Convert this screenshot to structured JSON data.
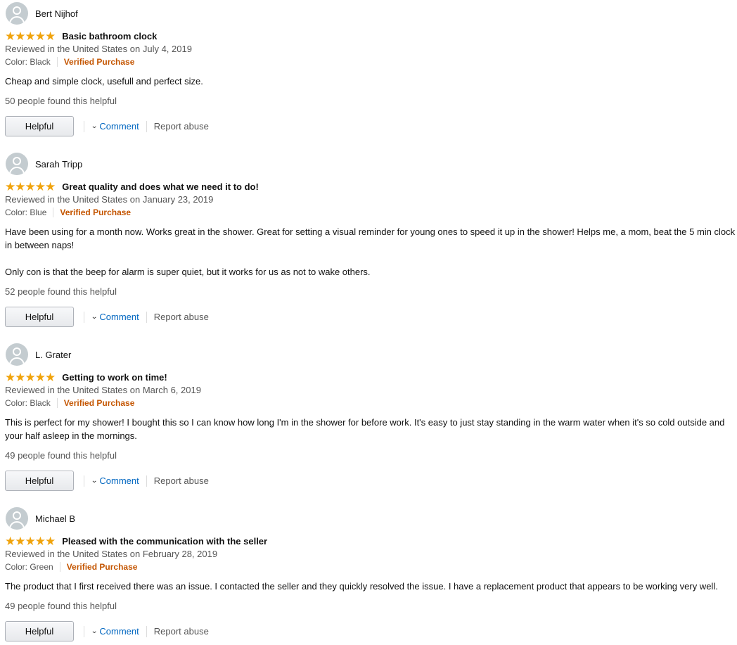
{
  "reviews": [
    {
      "name": "Bert Nijhof",
      "rating": 5,
      "title": "Basic bathroom clock",
      "date": "Reviewed in the United States on July 4, 2019",
      "color": "Color: Black",
      "verified": "Verified Purchase",
      "body": [
        "Cheap and simple clock, usefull and perfect size."
      ],
      "helpful_count": "50 people found this helpful"
    },
    {
      "name": "Sarah Tripp",
      "rating": 5,
      "title": "Great quality and does what we need it to do!",
      "date": "Reviewed in the United States on January 23, 2019",
      "color": "Color: Blue",
      "verified": "Verified Purchase",
      "body": [
        "Have been using for a month now. Works great in the shower. Great for setting a visual reminder for young ones to speed it up in the shower! Helps me, a mom, beat the 5 min clock in between naps!",
        "Only con is that the beep for alarm is super quiet, but it works for us as not to wake others."
      ],
      "helpful_count": "52 people found this helpful"
    },
    {
      "name": "L. Grater",
      "rating": 5,
      "title": "Getting to work on time!",
      "date": "Reviewed in the United States on March 6, 2019",
      "color": "Color: Black",
      "verified": "Verified Purchase",
      "body": [
        "This is perfect for my shower! I bought this so I can know how long I'm in the shower for before work. It's easy to just stay standing in the warm water when it's so cold outside and your half asleep in the mornings."
      ],
      "helpful_count": "49 people found this helpful"
    },
    {
      "name": "Michael B",
      "rating": 5,
      "title": "Pleased with the communication with the seller",
      "date": "Reviewed in the United States on February 28, 2019",
      "color": "Color: Green",
      "verified": "Verified Purchase",
      "body": [
        "The product that I first received there was an issue. I contacted the seller and they quickly resolved the issue. I have a replacement product that appears to be working very well."
      ],
      "helpful_count": "49 people found this helpful"
    }
  ],
  "actions": {
    "helpful_label": "Helpful",
    "comment_label": "Comment",
    "report_label": "Report abuse"
  },
  "icons": {
    "avatar": "default-profile-avatar",
    "star": "star-icon",
    "comment_chevron": "chevron-down-icon"
  },
  "colors": {
    "star": "#f0a30c",
    "verified": "#c45500",
    "link": "#0066c0",
    "muted_text": "#555555"
  }
}
